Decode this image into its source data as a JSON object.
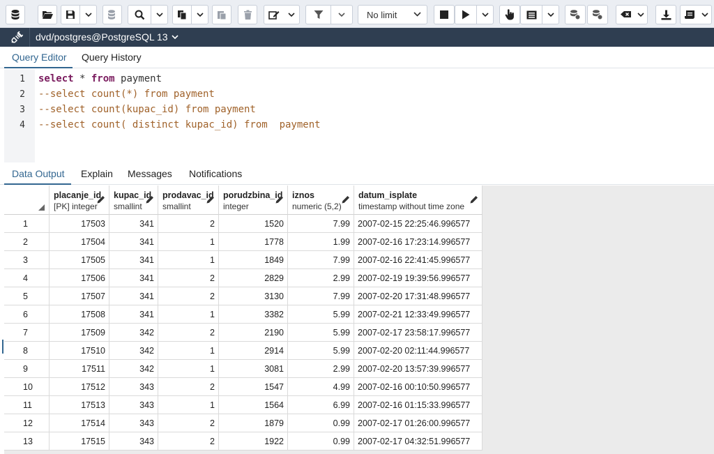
{
  "toolbar": {
    "limit_label": "No limit"
  },
  "connection": {
    "label": "dvd/postgres@PostgreSQL 13"
  },
  "editor_tabs": [
    {
      "label": "Query Editor",
      "active": true
    },
    {
      "label": "Query History",
      "active": false
    }
  ],
  "editor": {
    "lines": [
      {
        "n": "1",
        "kw1": "select",
        "t1": " * ",
        "kw2": "from",
        "t2": " payment",
        "comment": ""
      },
      {
        "n": "2",
        "comment": "--select count(*) from payment"
      },
      {
        "n": "3",
        "comment": "--select count(kupac_id) from payment"
      },
      {
        "n": "4",
        "comment": "--select count( distinct kupac_id) from  payment"
      }
    ]
  },
  "output_tabs": [
    {
      "label": "Data Output",
      "active": true
    },
    {
      "label": "Explain",
      "active": false
    },
    {
      "label": "Messages",
      "active": false
    },
    {
      "label": "Notifications",
      "active": false
    }
  ],
  "grid": {
    "columns": [
      {
        "name": "placanje_id",
        "type": "[PK] integer"
      },
      {
        "name": "kupac_id",
        "type": "smallint"
      },
      {
        "name": "prodavac_id",
        "type": "smallint"
      },
      {
        "name": "porudzbina_id",
        "type": "integer"
      },
      {
        "name": "iznos",
        "type": "numeric (5,2)"
      },
      {
        "name": "datum_isplate",
        "type": "timestamp without time zone"
      }
    ],
    "rows": [
      [
        "1",
        "17503",
        "341",
        "2",
        "1520",
        "7.99",
        "2007-02-15 22:25:46.996577"
      ],
      [
        "2",
        "17504",
        "341",
        "1",
        "1778",
        "1.99",
        "2007-02-16 17:23:14.996577"
      ],
      [
        "3",
        "17505",
        "341",
        "1",
        "1849",
        "7.99",
        "2007-02-16 22:41:45.996577"
      ],
      [
        "4",
        "17506",
        "341",
        "2",
        "2829",
        "2.99",
        "2007-02-19 19:39:56.996577"
      ],
      [
        "5",
        "17507",
        "341",
        "2",
        "3130",
        "7.99",
        "2007-02-20 17:31:48.996577"
      ],
      [
        "6",
        "17508",
        "341",
        "1",
        "3382",
        "5.99",
        "2007-02-21 12:33:49.996577"
      ],
      [
        "7",
        "17509",
        "342",
        "2",
        "2190",
        "5.99",
        "2007-02-17 23:58:17.996577"
      ],
      [
        "8",
        "17510",
        "342",
        "1",
        "2914",
        "5.99",
        "2007-02-20 02:11:44.996577"
      ],
      [
        "9",
        "17511",
        "342",
        "1",
        "3081",
        "2.99",
        "2007-02-20 13:57:39.996577"
      ],
      [
        "10",
        "17512",
        "343",
        "2",
        "1547",
        "4.99",
        "2007-02-16 00:10:50.996577"
      ],
      [
        "11",
        "17513",
        "343",
        "1",
        "1564",
        "6.99",
        "2007-02-16 01:15:33.996577"
      ],
      [
        "12",
        "17514",
        "343",
        "2",
        "1879",
        "0.99",
        "2007-02-17 01:26:00.996577"
      ],
      [
        "13",
        "17515",
        "343",
        "2",
        "1922",
        "0.99",
        "2007-02-17 04:32:51.996577"
      ]
    ]
  }
}
